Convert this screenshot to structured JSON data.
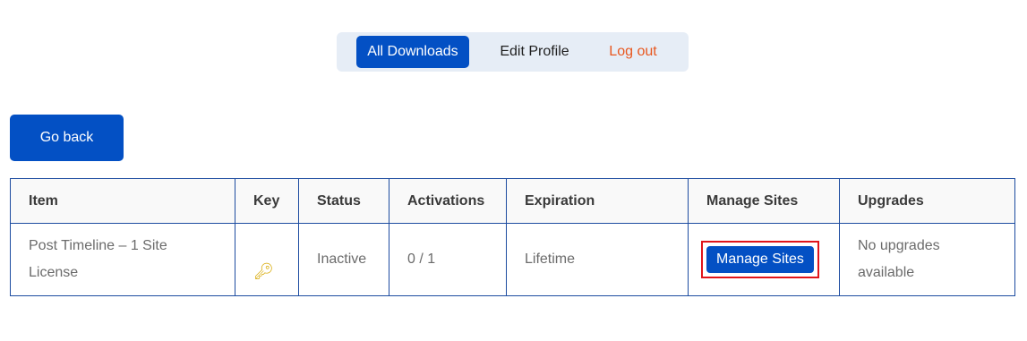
{
  "nav": {
    "all_downloads": "All Downloads",
    "edit_profile": "Edit Profile",
    "log_out": "Log out"
  },
  "go_back_label": "Go back",
  "table": {
    "headers": [
      "Item",
      "Key",
      "Status",
      "Activations",
      "Expiration",
      "Manage Sites",
      "Upgrades"
    ],
    "row": {
      "item": "Post Timeline – 1 Site License",
      "key_icon": "key-icon",
      "status": "Inactive",
      "activations": "0 / 1",
      "expiration": "Lifetime",
      "manage_sites_label": "Manage Sites",
      "upgrades": "No upgrades available"
    }
  },
  "colors": {
    "accent": "#0350c4",
    "logout": "#e8571f",
    "highlight_box": "#e0141a",
    "table_border": "#1d4ca0"
  }
}
